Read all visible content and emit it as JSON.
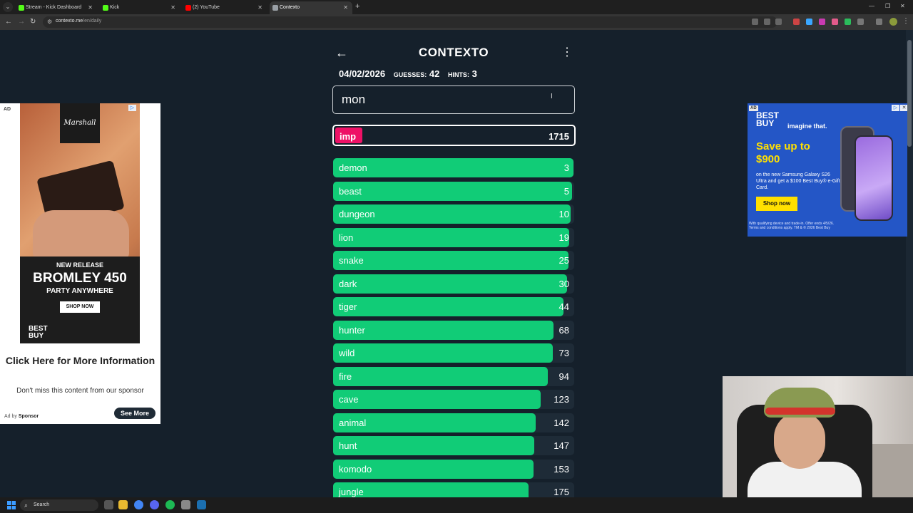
{
  "browser": {
    "tabs": [
      {
        "title": "Stream - Kick Dashboard",
        "favicon_color": "#53fc18",
        "active": false
      },
      {
        "title": "Kick",
        "favicon_color": "#53fc18",
        "active": false
      },
      {
        "title": "(2) YouTube",
        "favicon_color": "#ff0000",
        "active": false
      },
      {
        "title": "Contexto",
        "favicon_color": "#9aa0a6",
        "active": true
      }
    ],
    "new_tab_glyph": "+",
    "address": {
      "domain": "contexto.me",
      "path": "/en/daily"
    }
  },
  "game": {
    "title": "CONTEXTO",
    "date": "04/02/2026",
    "guesses_label": "GUESSES:",
    "guesses": "42",
    "hints_label": "HINTS:",
    "hints": "3",
    "input_value": "mon",
    "last_guess": {
      "word": "imp",
      "distance": "1715",
      "color": "#ee1166"
    },
    "guess_list": [
      {
        "word": "demon",
        "distance": "3",
        "fill": 0.998
      },
      {
        "word": "beast",
        "distance": "5",
        "fill": 0.99
      },
      {
        "word": "dungeon",
        "distance": "10",
        "fill": 0.985
      },
      {
        "word": "lion",
        "distance": "19",
        "fill": 0.98
      },
      {
        "word": "snake",
        "distance": "25",
        "fill": 0.975
      },
      {
        "word": "dark",
        "distance": "30",
        "fill": 0.97
      },
      {
        "word": "tiger",
        "distance": "44",
        "fill": 0.955
      },
      {
        "word": "hunter",
        "distance": "68",
        "fill": 0.915
      },
      {
        "word": "wild",
        "distance": "73",
        "fill": 0.91
      },
      {
        "word": "fire",
        "distance": "94",
        "fill": 0.89
      },
      {
        "word": "cave",
        "distance": "123",
        "fill": 0.86
      },
      {
        "word": "animal",
        "distance": "142",
        "fill": 0.84
      },
      {
        "word": "hunt",
        "distance": "147",
        "fill": 0.835
      },
      {
        "word": "komodo",
        "distance": "153",
        "fill": 0.83
      },
      {
        "word": "jungle",
        "distance": "175",
        "fill": 0.81
      }
    ],
    "colors": {
      "close": "#11cc77",
      "far": "#ee1166",
      "background": "#15202b"
    }
  },
  "ad_left": {
    "ad_label": "AD",
    "brand": "Marshall",
    "new_release": "NEW RELEASE",
    "product": "BROMLEY 450",
    "tagline": "PARTY ANYWHERE",
    "shop_now": "SHOP NOW",
    "retailer": "BEST BUY",
    "click_text": "Click Here for More Information",
    "sub_text": "Don't miss this content from our sponsor",
    "ad_by_prefix": "Ad by",
    "ad_by_name": "Sponsor",
    "see_more": "See More"
  },
  "ad_right": {
    "ad_label": "AD",
    "retailer": "BEST BUY",
    "tagline": "imagine that.",
    "headline": "Save up to $900",
    "description": "on the new Samsung Galaxy S26 Ultra and get a $100 Best Buy® e-Gift Card.",
    "cta": "Shop now",
    "fine_print": "With qualifying device and trade-in. Offer ends 4/5/26. Terms and conditions apply. TM & © 2026 Best Buy"
  },
  "taskbar": {
    "search_placeholder": "Search"
  }
}
